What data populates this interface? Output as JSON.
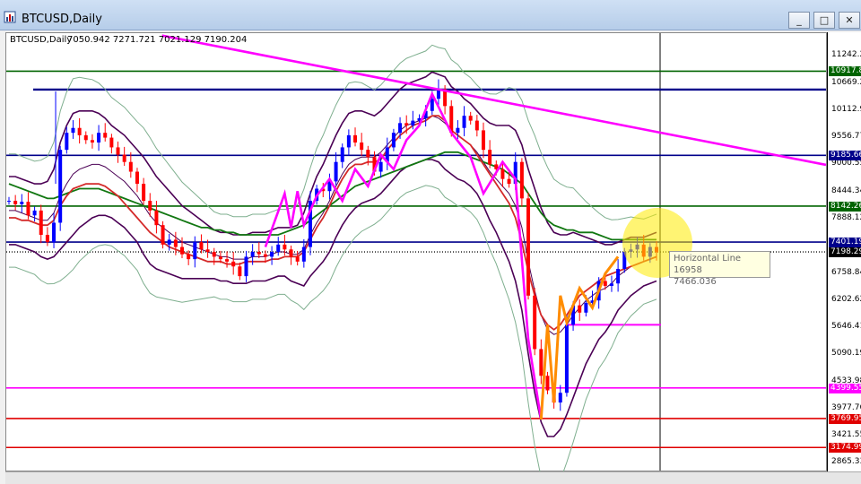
{
  "window": {
    "title": "BTCUSD,Daily",
    "icons": {
      "app": "chart-window-icon",
      "minimize": "minimize-icon",
      "maximize": "maximize-icon",
      "close": "close-icon"
    },
    "buttons": {
      "minimize": "_",
      "maximize": "□",
      "close": "✕"
    }
  },
  "chart_header": {
    "symbol": "BTCUSD,Daily",
    "ohlc": "7050.942 7271.721 7021.129 7190.204"
  },
  "tooltip": {
    "name": "Horizontal Line 16958",
    "value": "7466.036"
  },
  "colors": {
    "bull": "#0000ff",
    "bear": "#ff0000",
    "navy": "#00008b",
    "green": "#006400",
    "magenta": "#ff00ff",
    "red": "#e00000",
    "orange": "#ff8c00",
    "sage": "#7faf8f",
    "purple": "#4b0055",
    "maRed": "#d42a2a",
    "maGreen": "#117711"
  },
  "chart_data": {
    "type": "candlestick",
    "symbol": "BTCUSD",
    "timeframe": "Daily",
    "ylim": [
      2700,
      11700
    ],
    "price_ticks": [
      "11242.2",
      "10669.2",
      "10112.9",
      "9556.770",
      "9000.555",
      "8444.340",
      "7888.125",
      "7331.910",
      "6758.840",
      "6202.625",
      "5646.410",
      "5090.195",
      "4533.980",
      "3977.765",
      "3421.550",
      "2865.335"
    ],
    "price_tick_values": [
      11242.2,
      10669.2,
      10112.9,
      9556.77,
      9000.555,
      8444.34,
      7888.125,
      7331.91,
      6758.84,
      6202.625,
      5646.41,
      5090.195,
      4533.98,
      3977.765,
      3421.55,
      2865.335
    ],
    "horizontal_lines": [
      {
        "label": "10917.8",
        "price": 10917.8,
        "color": "#006400"
      },
      {
        "label": "9185.66",
        "price": 9185.66,
        "color": "#00008b"
      },
      {
        "label": "8142.26",
        "price": 8142.26,
        "color": "#006400"
      },
      {
        "label": "7401.19",
        "price": 7401.19,
        "color": "#00008b"
      },
      {
        "label": "7198.29",
        "price": 7198.29,
        "color": "#333333"
      },
      {
        "label": "4399.55",
        "price": 4399.55,
        "color": "#ff00ff"
      },
      {
        "label": "3769.95",
        "price": 3769.95,
        "color": "#e00000"
      },
      {
        "label": "3174.99",
        "price": 3174.99,
        "color": "#e00000"
      }
    ],
    "upper_resistance": 10540,
    "support_short": 5700,
    "trendline": [
      [
        0.19,
        11650
      ],
      [
        1.0,
        8990
      ]
    ],
    "closes": [
      8250,
      8180,
      8230,
      7950,
      8050,
      7550,
      7400,
      7800,
      9300,
      9650,
      9750,
      9600,
      9500,
      9450,
      9650,
      9550,
      9350,
      9200,
      9050,
      8850,
      8600,
      8250,
      8050,
      7750,
      7350,
      7450,
      7300,
      7150,
      7050,
      7400,
      7250,
      7200,
      7100,
      7050,
      7000,
      6900,
      6700,
      7100,
      7200,
      7150,
      7100,
      7200,
      7350,
      7250,
      7100,
      7000,
      7300,
      8250,
      8500,
      8450,
      8650,
      9050,
      9350,
      9600,
      9450,
      9300,
      9150,
      8850,
      9050,
      9350,
      9650,
      9850,
      9800,
      9900,
      9950,
      10100,
      10350,
      10550,
      10200,
      9650,
      9750,
      10000,
      9900,
      9700,
      9300,
      9000,
      8900,
      8700,
      8600,
      9050,
      8300,
      6300,
      5200,
      4650,
      4350,
      4100,
      4300,
      5700,
      6100,
      5950,
      6150,
      6200,
      6600,
      6500,
      6550,
      6850,
      7200,
      7250,
      7350,
      7100,
      7300,
      7190
    ],
    "bands": {
      "mid": [
        8050,
        8050,
        8000,
        7950,
        7900,
        7850,
        7850,
        8000,
        8350,
        8600,
        8800,
        8900,
        8950,
        9000,
        9000,
        8950,
        8850,
        8750,
        8650,
        8500,
        8350,
        8150,
        7950,
        7800,
        7700,
        7600,
        7500,
        7400,
        7350,
        7300,
        7250,
        7200,
        7150,
        7100,
        7100,
        7050,
        7050,
        7050,
        7100,
        7100,
        7100,
        7150,
        7200,
        7200,
        7150,
        7150,
        7250,
        7550,
        7800,
        8000,
        8250,
        8550,
        8800,
        9000,
        9100,
        9150,
        9150,
        9150,
        9250,
        9400,
        9550,
        9700,
        9800,
        9850,
        9900,
        9950,
        10000,
        9950,
        9850,
        9700,
        9600,
        9500,
        9400,
        9250,
        9050,
        8850,
        8700,
        8550,
        8400,
        8150,
        7700,
        7000,
        6400,
        5900,
        5600,
        5500,
        5550,
        5700,
        5900,
        6050,
        6200,
        6300,
        6400,
        6450,
        6550,
        6700,
        6800,
        6900,
        6950,
        7000,
        7050,
        7100
      ],
      "width": [
        700,
        700,
        700,
        700,
        700,
        750,
        800,
        900,
        1100,
        1200,
        1250,
        1200,
        1150,
        1100,
        1050,
        1000,
        950,
        950,
        950,
        950,
        950,
        1000,
        1000,
        950,
        900,
        850,
        800,
        750,
        700,
        650,
        600,
        550,
        500,
        500,
        500,
        500,
        500,
        500,
        500,
        500,
        500,
        500,
        500,
        500,
        550,
        600,
        750,
        850,
        950,
        1000,
        1050,
        1050,
        1050,
        1050,
        1000,
        950,
        900,
        850,
        850,
        850,
        850,
        850,
        850,
        850,
        850,
        850,
        900,
        900,
        950,
        900,
        900,
        850,
        850,
        850,
        900,
        1000,
        1100,
        1250,
        1400,
        1550,
        1700,
        1900,
        2100,
        2200,
        2200,
        2100,
        2000,
        1850,
        1700,
        1500,
        1300,
        1150,
        1000,
        900,
        800,
        700,
        650,
        600,
        550,
        500,
        500,
        500
      ]
    },
    "ma_red": [
      7900,
      7900,
      7850,
      7850,
      7800,
      7750,
      7750,
      7850,
      8150,
      8350,
      8500,
      8550,
      8600,
      8600,
      8600,
      8550,
      8450,
      8350,
      8200,
      8050,
      7900,
      7750,
      7600,
      7500,
      7400,
      7300,
      7250,
      7200,
      7150,
      7100,
      7050,
      7000,
      7000,
      7000,
      6950,
      6950,
      6950,
      7000,
      7000,
      7000,
      7000,
      7050,
      7050,
      7100,
      7100,
      7100,
      7200,
      7450,
      7700,
      7900,
      8150,
      8450,
      8700,
      8900,
      9000,
      9000,
      9050,
      9050,
      9100,
      9300,
      9450,
      9600,
      9700,
      9800,
      9850,
      9900,
      10000,
      10000,
      9900,
      9700,
      9600,
      9500,
      9400,
      9200,
      9000,
      8800,
      8600,
      8400,
      8200,
      7900,
      7400,
      6800,
      6300,
      5900,
      5700,
      5600,
      5700,
      5900,
      6100,
      6300,
      6400,
      6500,
      6600,
      6700,
      6750,
      6800,
      6850,
      6900,
      6950,
      7000,
      7050,
      7100
    ],
    "ma_green": [
      8600,
      8550,
      8500,
      8450,
      8400,
      8350,
      8300,
      8300,
      8350,
      8400,
      8450,
      8500,
      8500,
      8500,
      8500,
      8450,
      8400,
      8350,
      8300,
      8250,
      8200,
      8150,
      8100,
      8050,
      8000,
      7950,
      7900,
      7850,
      7800,
      7750,
      7700,
      7700,
      7650,
      7650,
      7600,
      7600,
      7550,
      7550,
      7550,
      7550,
      7550,
      7550,
      7550,
      7600,
      7650,
      7700,
      7750,
      7850,
      7950,
      8050,
      8150,
      8250,
      8350,
      8450,
      8550,
      8600,
      8650,
      8700,
      8750,
      8800,
      8850,
      8900,
      8950,
      9000,
      9050,
      9100,
      9150,
      9200,
      9250,
      9250,
      9250,
      9200,
      9150,
      9100,
      9050,
      9000,
      8950,
      8900,
      8800,
      8700,
      8600,
      8400,
      8200,
      8000,
      7850,
      7750,
      7700,
      7650,
      7650,
      7600,
      7600,
      7600,
      7550,
      7500,
      7450,
      7450,
      7450,
      7450,
      7450,
      7450,
      7450,
      7450
    ]
  }
}
